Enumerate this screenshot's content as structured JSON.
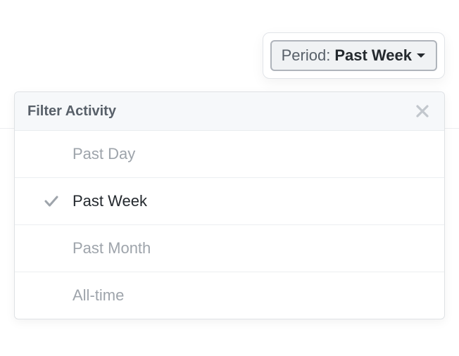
{
  "period_button": {
    "label": "Period:",
    "value": "Past Week"
  },
  "panel": {
    "title": "Filter Activity",
    "selected_index": 1,
    "options": [
      {
        "label": "Past Day"
      },
      {
        "label": "Past Week"
      },
      {
        "label": "Past Month"
      },
      {
        "label": "All-time"
      }
    ]
  }
}
